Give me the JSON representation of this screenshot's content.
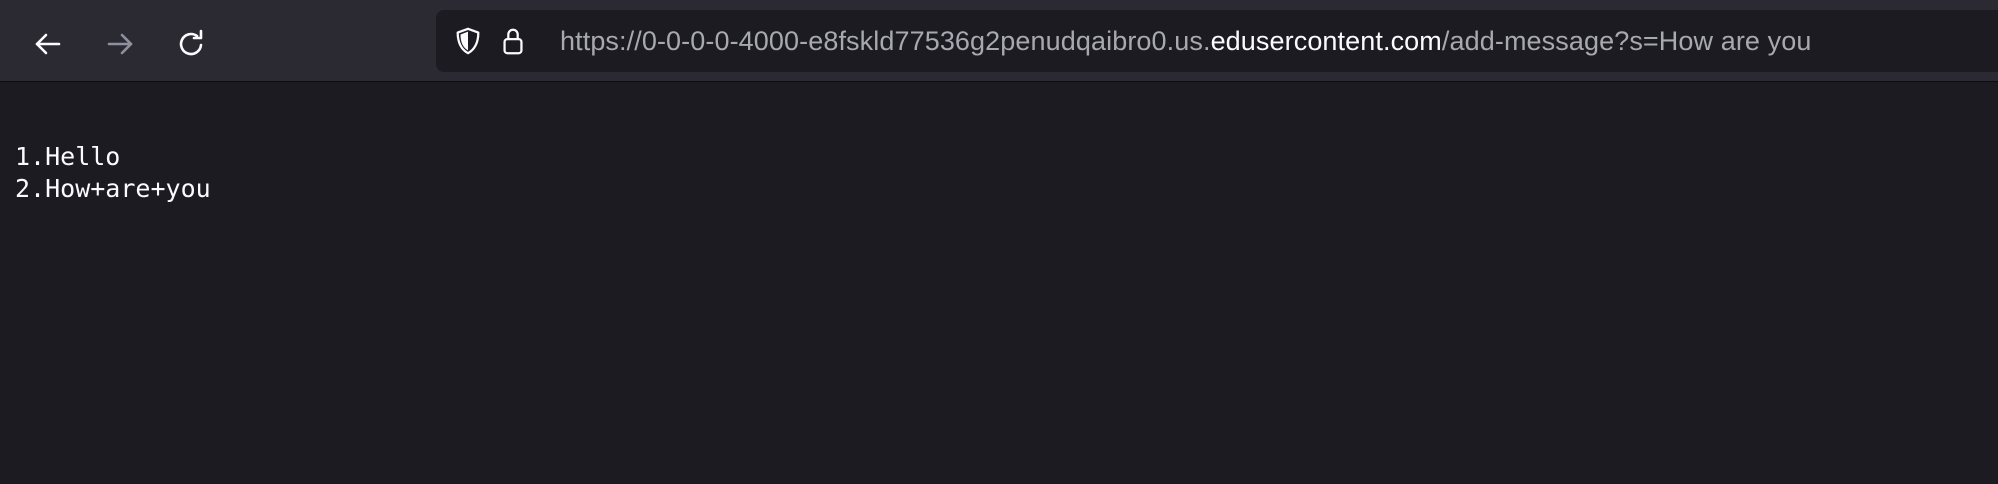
{
  "toolbar": {
    "back_icon": "arrow-left-icon",
    "forward_icon": "arrow-right-icon",
    "reload_icon": "reload-icon"
  },
  "urlbar": {
    "shield_icon": "shield-icon",
    "lock_icon": "lock-icon",
    "url_prefix": "https://0-0-0-0-4000-e8fskld77536g2penudqaibro0.us.",
    "url_domain": "edusercontent.com",
    "url_suffix": "/add-message?s=How are you"
  },
  "page": {
    "lines": [
      "1.Hello",
      "2.How+are+you"
    ]
  },
  "colors": {
    "toolbar_bg": "#2b2a33",
    "page_bg": "#1c1b22",
    "text": "#fbfbfe",
    "url_dim": "#a8a8b0"
  }
}
